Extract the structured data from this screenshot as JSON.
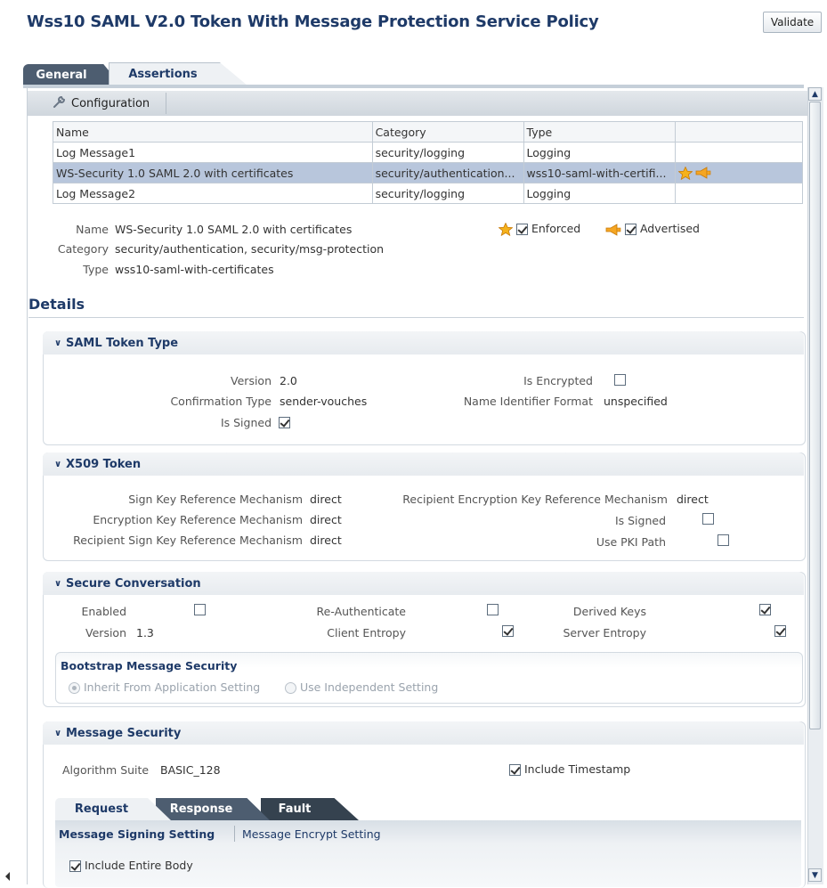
{
  "title": "Wss10 SAML V2.0 Token With Message Protection Service Policy",
  "validate_label": "Validate",
  "tabs": {
    "general": "General",
    "assertions": "Assertions"
  },
  "toolbar": {
    "configuration": "Configuration"
  },
  "grid": {
    "headers": [
      "Name",
      "Category",
      "Type"
    ],
    "rows": [
      {
        "name": "Log Message1",
        "category": "security/logging",
        "type": "Logging"
      },
      {
        "name": "WS-Security 1.0 SAML 2.0 with certificates",
        "category": "security/authentication...",
        "type": "wss10-saml-with-certifi..."
      },
      {
        "name": "Log Message2",
        "category": "security/logging",
        "type": "Logging"
      }
    ]
  },
  "info": {
    "name_label": "Name",
    "name_value": "WS-Security 1.0 SAML 2.0 with certificates",
    "category_label": "Category",
    "category_value": "security/authentication, security/msg-protection",
    "type_label": "Type",
    "type_value": "wss10-saml-with-certificates",
    "enforced": "Enforced",
    "advertised": "Advertised"
  },
  "details_title": "Details",
  "saml": {
    "title": "SAML Token Type",
    "version_label": "Version",
    "version_value": "2.0",
    "conf_label": "Confirmation Type",
    "conf_value": "sender-vouches",
    "signed_label": "Is Signed",
    "encrypted_label": "Is Encrypted",
    "nameid_label": "Name Identifier Format",
    "nameid_value": "unspecified"
  },
  "x509": {
    "title": "X509 Token",
    "sign_key_label": "Sign Key Reference Mechanism",
    "sign_key_value": "direct",
    "enc_key_label": "Encryption Key Reference Mechanism",
    "enc_key_value": "direct",
    "rec_sign_label": "Recipient Sign Key Reference Mechanism",
    "rec_sign_value": "direct",
    "rec_enc_label": "Recipient Encryption Key Reference Mechanism",
    "rec_enc_value": "direct",
    "signed_label": "Is Signed",
    "pki_label": "Use PKI Path"
  },
  "secconv": {
    "title": "Secure Conversation",
    "enabled_label": "Enabled",
    "version_label": "Version",
    "version_value": "1.3",
    "reauth_label": "Re-Authenticate",
    "client_entropy_label": "Client Entropy",
    "derived_keys_label": "Derived Keys",
    "server_entropy_label": "Server Entropy",
    "bootstrap_title": "Bootstrap Message Security",
    "inherit_label": "Inherit From Application Setting",
    "independent_label": "Use Independent Setting"
  },
  "msgsec": {
    "title": "Message Security",
    "alg_label": "Algorithm Suite",
    "alg_value": "BASIC_128",
    "timestamp_label": "Include Timestamp",
    "subtabs": {
      "request": "Request",
      "response": "Response",
      "fault": "Fault"
    },
    "signing_link": "Message Signing Setting",
    "encrypt_link": "Message Encrypt Setting",
    "entire_body_label": "Include Entire Body"
  }
}
